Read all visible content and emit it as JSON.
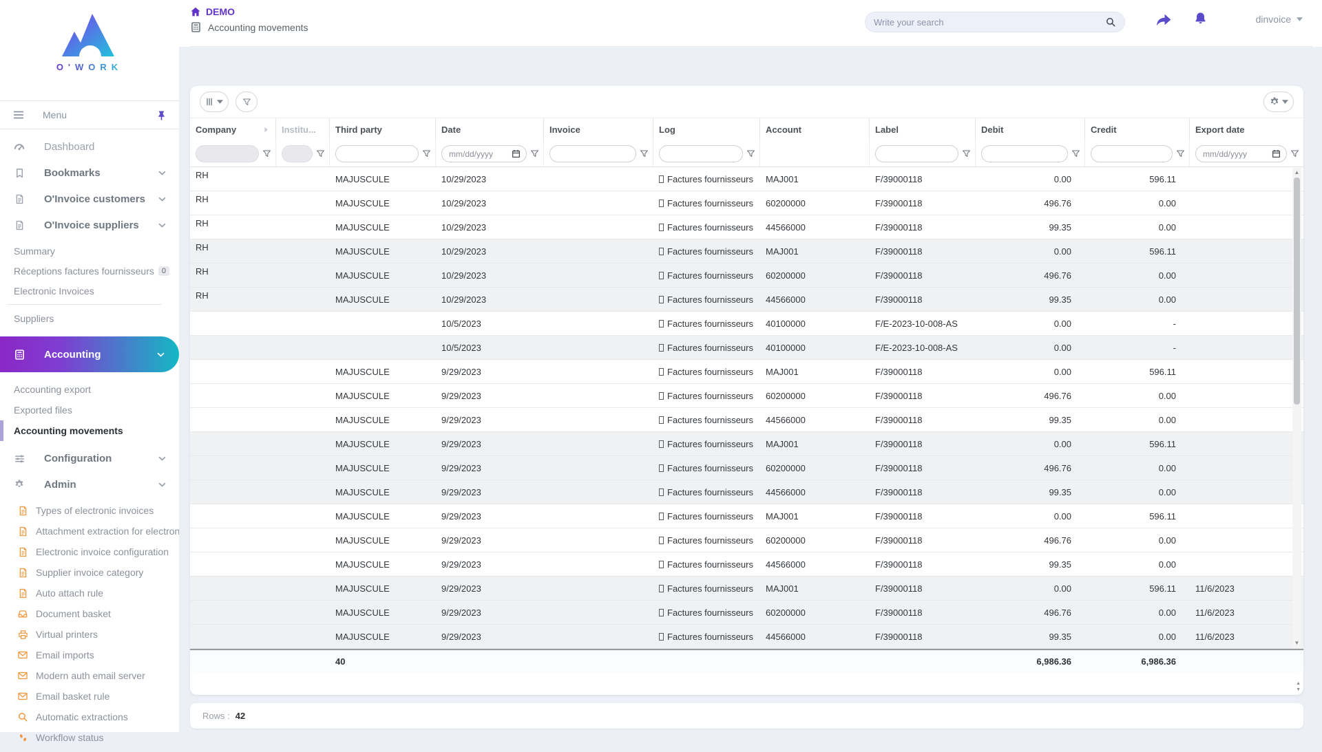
{
  "brand": {
    "name": "O'WORK"
  },
  "header": {
    "app_title": "DEMO",
    "page_title": "Accounting movements",
    "search_placeholder": "Write your search",
    "user": "dinvoice"
  },
  "sidebar": {
    "menu_label": "Menu",
    "dashboard": "Dashboard",
    "bookmarks": "Bookmarks",
    "oinvoice_customers": "O'Invoice customers",
    "oinvoice_suppliers": "O'Invoice suppliers",
    "suppliers_children": [
      {
        "label": "Summary"
      },
      {
        "label": "Réceptions factures fournisseurs",
        "badge": "0"
      },
      {
        "label": "Electronic Invoices",
        "divider_after": true
      },
      {
        "label": "Suppliers"
      }
    ],
    "accounting": "Accounting",
    "accounting_children": [
      {
        "label": "Accounting export"
      },
      {
        "label": "Exported files"
      },
      {
        "label": "Accounting movements",
        "active": true
      }
    ],
    "configuration": "Configuration",
    "admin": "Admin",
    "admin_children": [
      {
        "label": "Types of electronic invoices",
        "icon": "document"
      },
      {
        "label": "Attachment extraction for electron",
        "icon": "document"
      },
      {
        "label": "Electronic invoice configuration",
        "icon": "document"
      },
      {
        "label": "Supplier invoice category",
        "icon": "document"
      },
      {
        "label": "Auto attach rule",
        "icon": "document"
      },
      {
        "label": "Document basket",
        "icon": "inbox"
      },
      {
        "label": "Virtual printers",
        "icon": "printer"
      },
      {
        "label": "Email imports",
        "icon": "mail"
      },
      {
        "label": "Modern auth email server",
        "icon": "mail"
      },
      {
        "label": "Email basket rule",
        "icon": "mail"
      },
      {
        "label": "Automatic extractions",
        "icon": "magnifier"
      },
      {
        "label": "Workflow status",
        "icon": "footprints"
      }
    ]
  },
  "table": {
    "columns": [
      "Company",
      "Institu...",
      "Third party",
      "Date",
      "Invoice",
      "Log",
      "Account",
      "Label",
      "Debit",
      "Credit",
      "Export date"
    ],
    "date_placeholder": "mm/dd/yyyy",
    "log_prefix": "[]",
    "rows": [
      {
        "company": "RH",
        "institution": "",
        "third_party": "MAJUSCULE",
        "date": "10/29/2023",
        "invoice": "",
        "log": "Factures fournisseurs",
        "account": "MAJ001",
        "label": "F/39000118",
        "debit": "0.00",
        "credit": "596.11",
        "export_date": "",
        "shaded": false
      },
      {
        "company": "RH",
        "institution": "",
        "third_party": "MAJUSCULE",
        "date": "10/29/2023",
        "invoice": "",
        "log": "Factures fournisseurs",
        "account": "60200000",
        "label": "F/39000118",
        "debit": "496.76",
        "credit": "0.00",
        "export_date": "",
        "shaded": false
      },
      {
        "company": "RH",
        "institution": "",
        "third_party": "MAJUSCULE",
        "date": "10/29/2023",
        "invoice": "",
        "log": "Factures fournisseurs",
        "account": "44566000",
        "label": "F/39000118",
        "debit": "99.35",
        "credit": "0.00",
        "export_date": "",
        "shaded": false
      },
      {
        "company": "RH",
        "institution": "",
        "third_party": "MAJUSCULE",
        "date": "10/29/2023",
        "invoice": "",
        "log": "Factures fournisseurs",
        "account": "MAJ001",
        "label": "F/39000118",
        "debit": "0.00",
        "credit": "596.11",
        "export_date": "",
        "shaded": true
      },
      {
        "company": "RH",
        "institution": "",
        "third_party": "MAJUSCULE",
        "date": "10/29/2023",
        "invoice": "",
        "log": "Factures fournisseurs",
        "account": "60200000",
        "label": "F/39000118",
        "debit": "496.76",
        "credit": "0.00",
        "export_date": "",
        "shaded": true
      },
      {
        "company": "RH",
        "institution": "",
        "third_party": "MAJUSCULE",
        "date": "10/29/2023",
        "invoice": "",
        "log": "Factures fournisseurs",
        "account": "44566000",
        "label": "F/39000118",
        "debit": "99.35",
        "credit": "0.00",
        "export_date": "",
        "shaded": true
      },
      {
        "company": "",
        "institution": "",
        "third_party": "",
        "date": "10/5/2023",
        "invoice": "",
        "log": "Factures fournisseurs",
        "account": "40100000",
        "label": "F/E-2023-10-008-AS",
        "debit": "0.00",
        "credit": "-",
        "export_date": "",
        "shaded": false
      },
      {
        "company": "",
        "institution": "",
        "third_party": "",
        "date": "10/5/2023",
        "invoice": "",
        "log": "Factures fournisseurs",
        "account": "40100000",
        "label": "F/E-2023-10-008-AS",
        "debit": "0.00",
        "credit": "-",
        "export_date": "",
        "shaded": true
      },
      {
        "company": "",
        "institution": "",
        "third_party": "MAJUSCULE",
        "date": "9/29/2023",
        "invoice": "",
        "log": "Factures fournisseurs",
        "account": "MAJ001",
        "label": "F/39000118",
        "debit": "0.00",
        "credit": "596.11",
        "export_date": "",
        "shaded": false
      },
      {
        "company": "",
        "institution": "",
        "third_party": "MAJUSCULE",
        "date": "9/29/2023",
        "invoice": "",
        "log": "Factures fournisseurs",
        "account": "60200000",
        "label": "F/39000118",
        "debit": "496.76",
        "credit": "0.00",
        "export_date": "",
        "shaded": false
      },
      {
        "company": "",
        "institution": "",
        "third_party": "MAJUSCULE",
        "date": "9/29/2023",
        "invoice": "",
        "log": "Factures fournisseurs",
        "account": "44566000",
        "label": "F/39000118",
        "debit": "99.35",
        "credit": "0.00",
        "export_date": "",
        "shaded": false
      },
      {
        "company": "",
        "institution": "",
        "third_party": "MAJUSCULE",
        "date": "9/29/2023",
        "invoice": "",
        "log": "Factures fournisseurs",
        "account": "MAJ001",
        "label": "F/39000118",
        "debit": "0.00",
        "credit": "596.11",
        "export_date": "",
        "shaded": true
      },
      {
        "company": "",
        "institution": "",
        "third_party": "MAJUSCULE",
        "date": "9/29/2023",
        "invoice": "",
        "log": "Factures fournisseurs",
        "account": "60200000",
        "label": "F/39000118",
        "debit": "496.76",
        "credit": "0.00",
        "export_date": "",
        "shaded": true
      },
      {
        "company": "",
        "institution": "",
        "third_party": "MAJUSCULE",
        "date": "9/29/2023",
        "invoice": "",
        "log": "Factures fournisseurs",
        "account": "44566000",
        "label": "F/39000118",
        "debit": "99.35",
        "credit": "0.00",
        "export_date": "",
        "shaded": true
      },
      {
        "company": "",
        "institution": "",
        "third_party": "MAJUSCULE",
        "date": "9/29/2023",
        "invoice": "",
        "log": "Factures fournisseurs",
        "account": "MAJ001",
        "label": "F/39000118",
        "debit": "0.00",
        "credit": "596.11",
        "export_date": "",
        "shaded": false
      },
      {
        "company": "",
        "institution": "",
        "third_party": "MAJUSCULE",
        "date": "9/29/2023",
        "invoice": "",
        "log": "Factures fournisseurs",
        "account": "60200000",
        "label": "F/39000118",
        "debit": "496.76",
        "credit": "0.00",
        "export_date": "",
        "shaded": false
      },
      {
        "company": "",
        "institution": "",
        "third_party": "MAJUSCULE",
        "date": "9/29/2023",
        "invoice": "",
        "log": "Factures fournisseurs",
        "account": "44566000",
        "label": "F/39000118",
        "debit": "99.35",
        "credit": "0.00",
        "export_date": "",
        "shaded": false
      },
      {
        "company": "",
        "institution": "",
        "third_party": "MAJUSCULE",
        "date": "9/29/2023",
        "invoice": "",
        "log": "Factures fournisseurs",
        "account": "MAJ001",
        "label": "F/39000118",
        "debit": "0.00",
        "credit": "596.11",
        "export_date": "11/6/2023",
        "shaded": true
      },
      {
        "company": "",
        "institution": "",
        "third_party": "MAJUSCULE",
        "date": "9/29/2023",
        "invoice": "",
        "log": "Factures fournisseurs",
        "account": "60200000",
        "label": "F/39000118",
        "debit": "496.76",
        "credit": "0.00",
        "export_date": "11/6/2023",
        "shaded": true
      },
      {
        "company": "",
        "institution": "",
        "third_party": "MAJUSCULE",
        "date": "9/29/2023",
        "invoice": "",
        "log": "Factures fournisseurs",
        "account": "44566000",
        "label": "F/39000118",
        "debit": "99.35",
        "credit": "0.00",
        "export_date": "11/6/2023",
        "shaded": true
      }
    ],
    "totals": {
      "count": "40",
      "debit": "6,986.36",
      "credit": "6,986.36"
    },
    "footer_label": "Rows :",
    "footer_value": "42"
  },
  "colors": {
    "accent_purple": "#6233c9",
    "icon_purple": "#5b4ac8",
    "gradient_start": "#8b27c6",
    "gradient_end": "#14b8c4",
    "admin_icon_orange": "#f0993f"
  }
}
